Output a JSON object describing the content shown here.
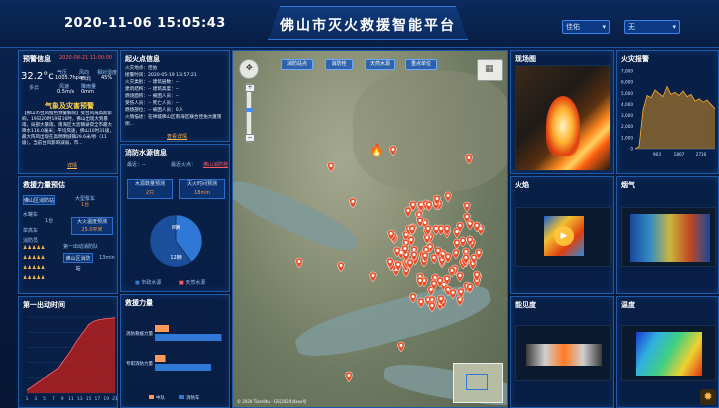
{
  "header": {
    "datetime": "2020-11-06 15:05:43",
    "title": "佛山市灭火救援智能平台",
    "select1": "佳佑",
    "select2": "无"
  },
  "warning": {
    "title": "预警信息",
    "date": "2020-08-21 11:00:00",
    "temp": "32.2°c",
    "condition": "多云",
    "labels": [
      "气压",
      "风向",
      "相对湿度"
    ],
    "values": [
      "1005.7hpa",
      "西北",
      "45%"
    ],
    "labels2": [
      "风速",
      "降雨量"
    ],
    "values2": [
      "0.5m/s",
      "0mm"
    ],
    "alert_title": "气象及灾害预警",
    "alert_text": "【佛山市台风橙色预警解除】受台风海高斯影响，19日20时19日16时，佛山出现大到暴雨，局部大暴雨，南海区大沥镇录得全市最大降水116.0毫米；平均风速，佛山10时31级，最大阵风出现在高明明城镇29.6米/秒（11级）。当前台风影响减弱，市...",
    "more": "详情"
  },
  "fire": {
    "title": "起火点信息",
    "rows": [
      "火灾地点：佳佑",
      "接警时间：2020-05-19 13:57:21",
      "火灾类别：--   建筑层数：--",
      "建筑结构：--   建筑高度：--",
      "燃烧面积：--   被困人员：--",
      "受伤人员：--   死亡人员：--",
      "燃烧部位：--   被困人员：0人"
    ],
    "desc": "火情描述：在禅城佛山区南海区联合佳佑大厦南侧...",
    "link": "查看详情"
  },
  "water": {
    "title": "消防水源信息",
    "near_label": "最近：--",
    "near_label2": "最近火点：",
    "near_link": "佛山消防栓",
    "box1_label": "水源数量预测",
    "box1_val": "2只",
    "box2_label": "灭火时间预测",
    "box2_val": "18min",
    "pie_top": "8辆",
    "pie_bottom": "12辆",
    "legend1": "市政水源",
    "legend2": "天然水源",
    "pie_values": [
      8,
      12
    ]
  },
  "forces": {
    "title": "救援力量预估",
    "row1": "佛山区消防站",
    "row1b": "大型泵车",
    "row1c": "1台",
    "row2": "水罐车",
    "row2b": "1台",
    "row3": "大火温度预测",
    "row3b": "25.0平米",
    "row4": "举高车",
    "row5": "消防员",
    "row6": "第一出动消防队",
    "row7": "佛山区消防站",
    "row7b": "13min"
  },
  "arrival": {
    "title": "第一出动时间",
    "x_ticks": [
      "1",
      "3",
      "5",
      "7",
      "9",
      "11",
      "13",
      "15",
      "17",
      "19",
      "21"
    ],
    "values": [
      0.2,
      0.4,
      0.6,
      0.8,
      1.0,
      1.2,
      1.4,
      1.6,
      2.0,
      2.4,
      2.8,
      3.3,
      3.7,
      4.1,
      4.5,
      4.7,
      4.8,
      4.85,
      4.9,
      4.92,
      4.95
    ]
  },
  "rescue": {
    "title": "救援力量",
    "cats": [
      "消防救援力量",
      "专职消防力量"
    ],
    "series1": [
      20,
      15
    ],
    "series2": [
      95,
      80
    ],
    "legend1": "中队",
    "legend2": "消防车"
  },
  "map": {
    "tabs": [
      "消防站点",
      "消防栓",
      "天然水源",
      "重点单位"
    ],
    "footer": "© 2020 Tianditu - GS(2020)4xxx号"
  },
  "scene": {
    "title": "现场图"
  },
  "forecast": {
    "title": "火灾报警",
    "y_ticks": [
      "7,000",
      "6,000",
      "5,000",
      "4,000",
      "3,000",
      "2,000",
      "1,000",
      "0"
    ],
    "x_ticks": [
      "903",
      "1807",
      "2710"
    ],
    "values": [
      0,
      200,
      3500,
      4800,
      4600,
      5300,
      5000,
      4700,
      5600,
      4900,
      5100,
      4800,
      5200,
      4700,
      4900,
      4300,
      4500,
      4200,
      4400,
      4000,
      3600
    ]
  },
  "cams": {
    "fire": "火焰",
    "smoke": "烟气",
    "heat": "能见度",
    "temp": "温度"
  }
}
